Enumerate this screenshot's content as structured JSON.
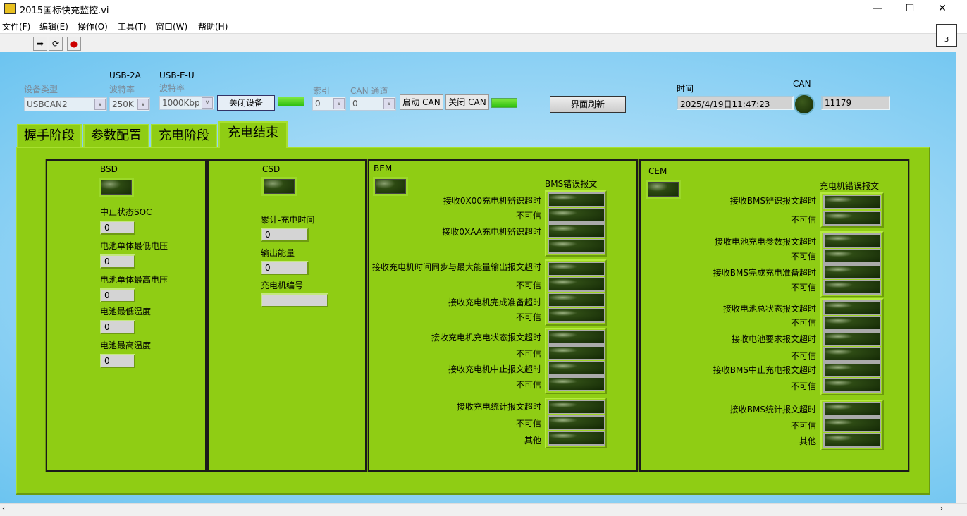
{
  "window": {
    "title": "2015国标快充监控.vi",
    "minimize": "—",
    "maximize": "☐",
    "close": "✕"
  },
  "menu": [
    "文件(F)",
    "编辑(E)",
    "操作(O)",
    "工具(T)",
    "窗口(W)",
    "帮助(H)"
  ],
  "toolbar": {
    "run": "➡",
    "run_continuous": "⟳",
    "abort": "●"
  },
  "vi_icon_text": "3",
  "device": {
    "type_label": "设备类型",
    "type_value": "USBCAN2",
    "usb2a_label": "USB-2A",
    "baud1_label": "波特率",
    "baud1_value": "250K",
    "usbeu_label": "USB-E-U",
    "baud2_label": "波特率",
    "baud2_value": "1000Kbp",
    "close_device": "关闭设备",
    "index_label": "索引",
    "index_value": "0",
    "channel_label": "CAN 通道",
    "channel_value": "0",
    "start_can": "启动 CAN",
    "close_can": "关闭 CAN",
    "refresh": "界面刷新",
    "time_label": "时间",
    "time_value": "2025/4/19日11:47:23",
    "can_label": "CAN",
    "count_value": "11179"
  },
  "tabs": [
    "握手阶段",
    "参数配置",
    "充电阶段",
    "充电结束"
  ],
  "active_tab": "充电结束",
  "bsd": {
    "title": "BSD",
    "fields": [
      {
        "label": "中止状态SOC",
        "value": "0"
      },
      {
        "label": "电池单体最低电压",
        "value": "0"
      },
      {
        "label": "电池单体最高电压",
        "value": "0"
      },
      {
        "label": "电池最低温度",
        "value": "0"
      },
      {
        "label": "电池最高温度",
        "value": "0"
      }
    ]
  },
  "csd": {
    "title": "CSD",
    "fields": [
      {
        "label": "累计-充电时间",
        "value": "0"
      },
      {
        "label": "输出能量",
        "value": "0"
      },
      {
        "label": "充电机编号",
        "value": ""
      }
    ]
  },
  "bem": {
    "title": "BEM",
    "subtitle": "BMS错误报文",
    "labels": [
      "接收0X00充电机辨识超时",
      "不可信",
      "接收0XAA充电机辨识超时",
      "接收充电机时间同步与最大能量输出报文超时",
      "不可信",
      "接收充电机完成准备超时",
      "不可信",
      "接收充电机充电状态报文超时",
      "不可信",
      "接收充电机中止报文超时",
      "不可信",
      "接收充电统计报文超时",
      "不可信",
      "其他"
    ]
  },
  "cem": {
    "title": "CEM",
    "subtitle": "充电机错误报文",
    "labels": [
      "接收BMS辨识报文超时",
      "不可信",
      "接收电池充电参数报文超时",
      "不可信",
      "接收BMS完成充电准备超时",
      "不可信",
      "接收电池总状态报文超时",
      "不可信",
      "接收电池要求报文超时",
      "不可信",
      "接收BMS中止充电报文超时",
      "不可信",
      "接收BMS统计报文超时",
      "不可信",
      "其他"
    ]
  }
}
